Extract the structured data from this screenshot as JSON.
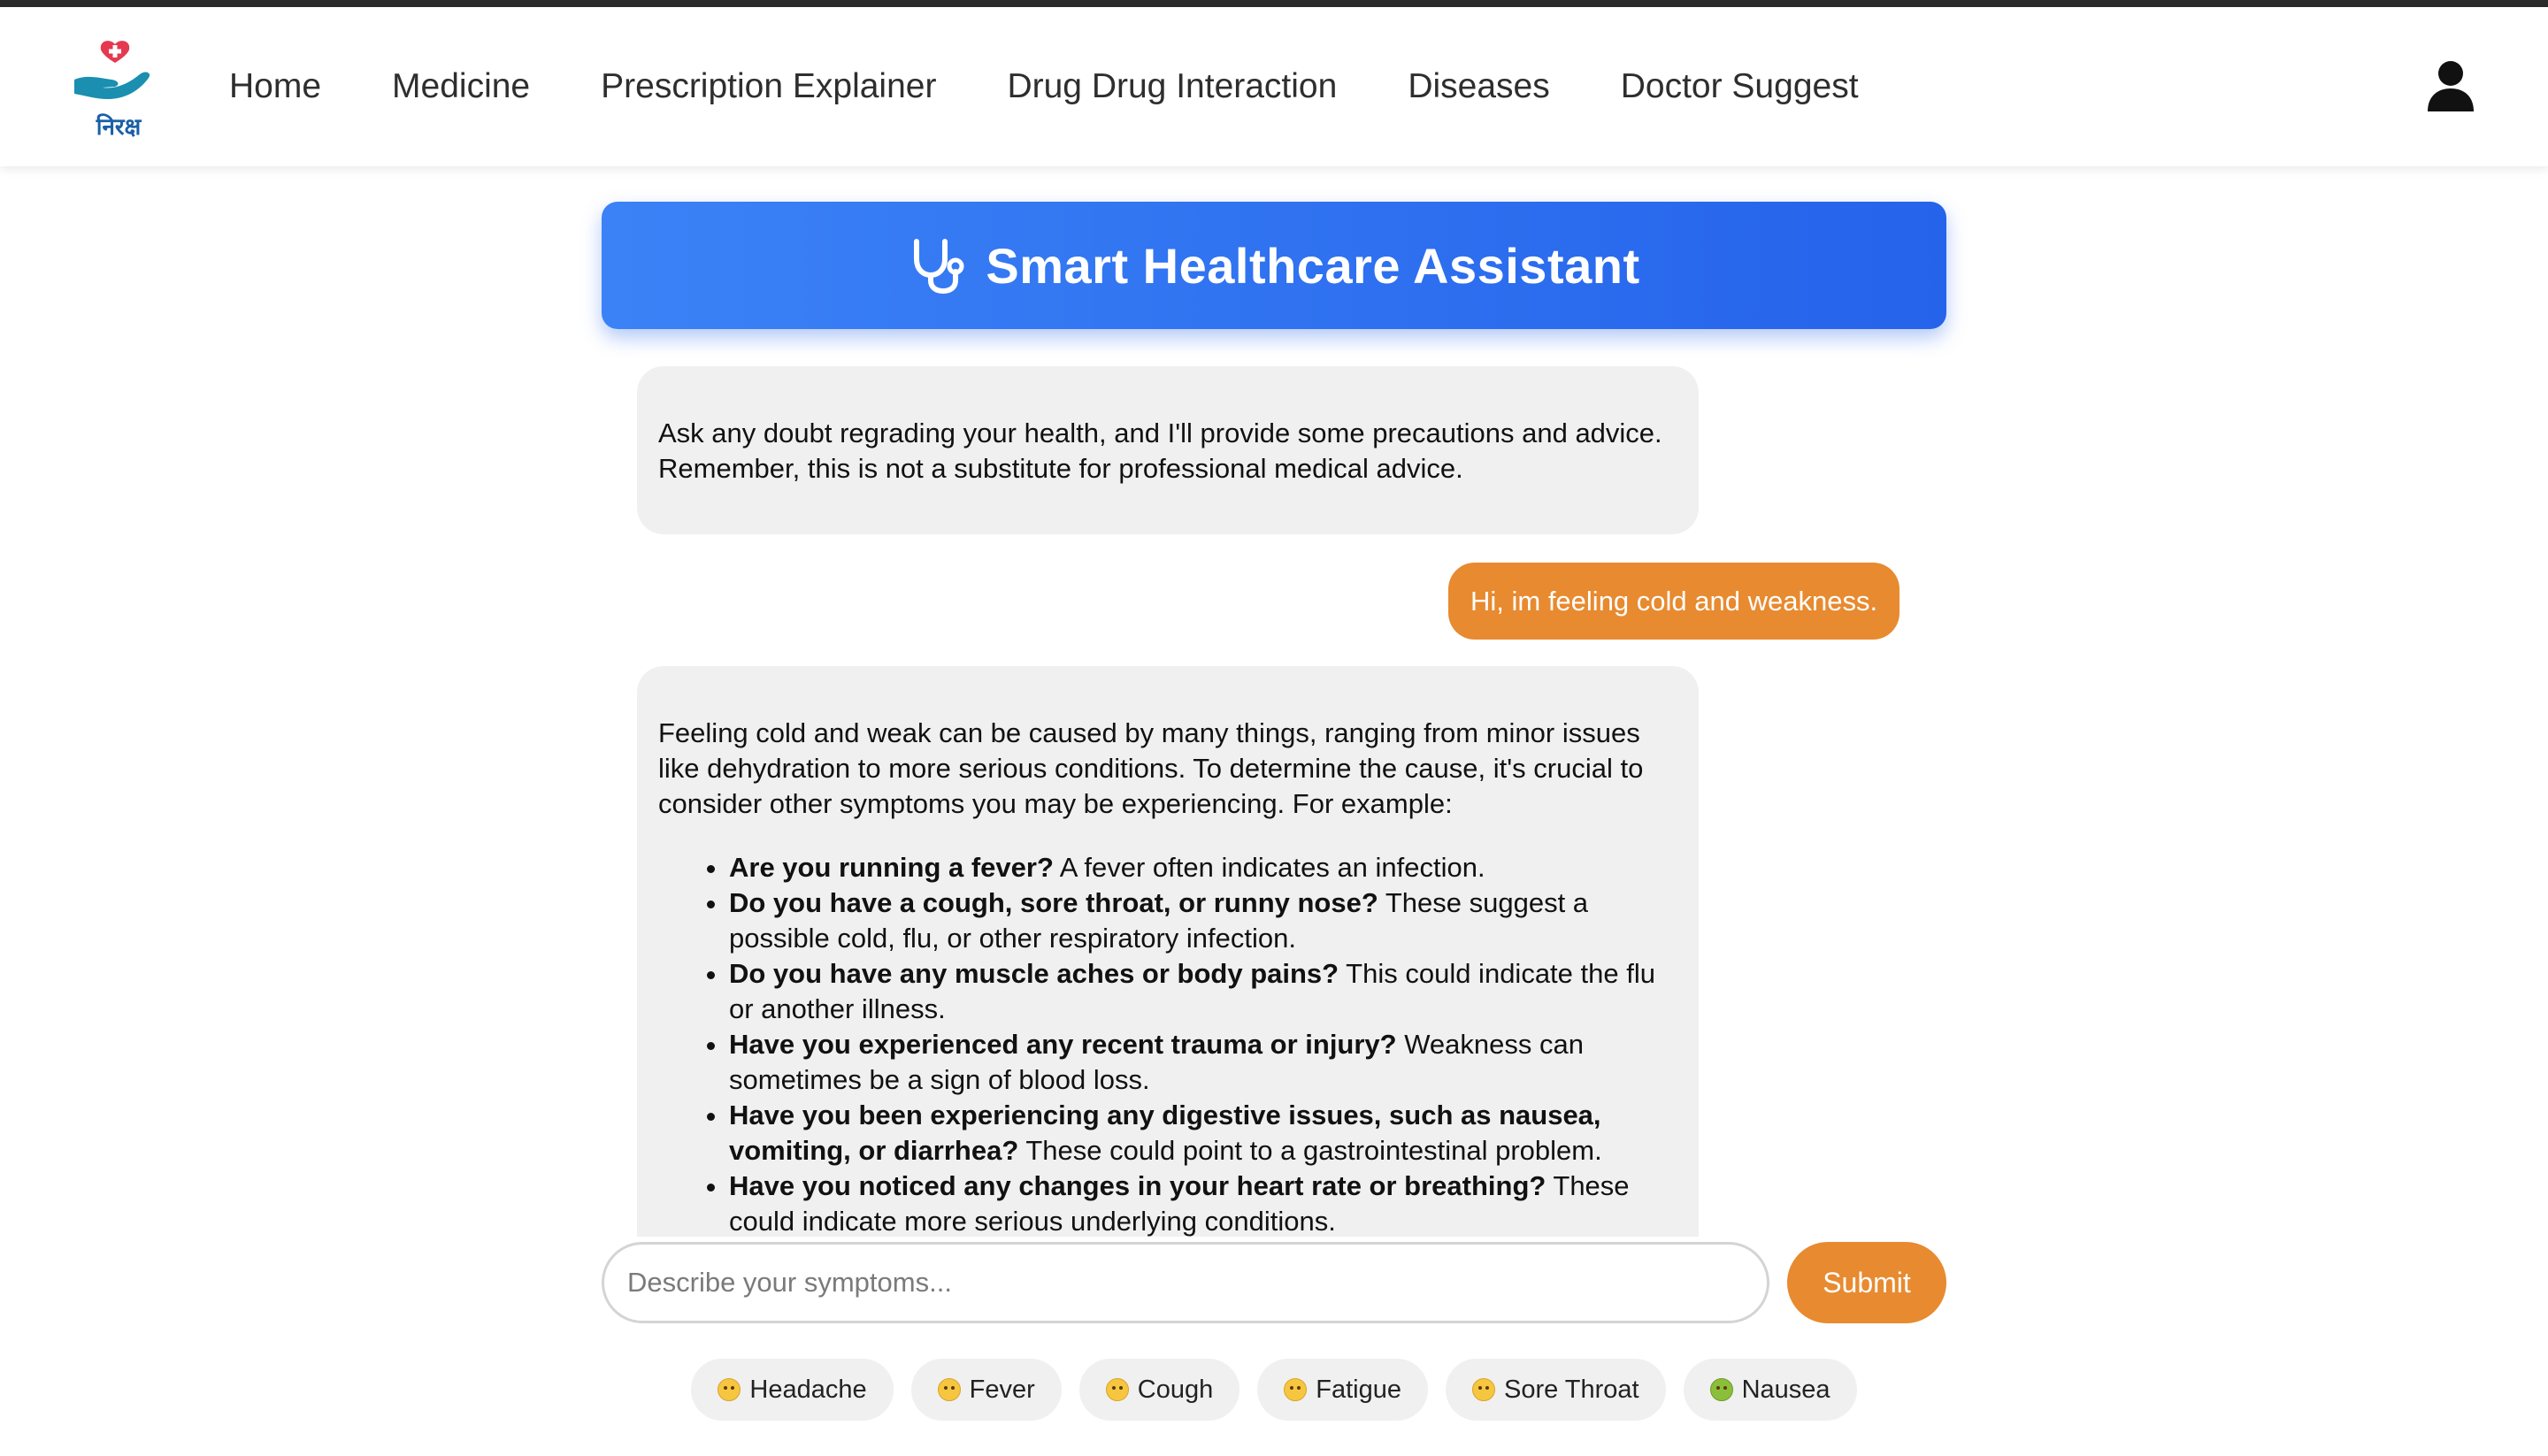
{
  "app": {
    "logo_text": "निरक्ष",
    "brand_colors": {
      "primary_blue": "#2563eb",
      "accent_orange": "#e88a2f",
      "logo_teal": "#1a8fb0",
      "logo_heart": "#e53950"
    }
  },
  "nav": {
    "links": [
      {
        "label": "Home"
      },
      {
        "label": "Medicine"
      },
      {
        "label": "Prescription Explainer"
      },
      {
        "label": "Drug Drug Interaction"
      },
      {
        "label": "Diseases"
      },
      {
        "label": "Doctor Suggest"
      }
    ],
    "user_icon": "user-icon"
  },
  "header": {
    "icon": "stethoscope-icon",
    "title": "Smart Healthcare Assistant"
  },
  "chat": {
    "messages": [
      {
        "role": "bot",
        "text": "Ask any doubt regrading your health, and I'll provide some precautions and advice. Remember, this is not a substitute for professional medical advice."
      },
      {
        "role": "user",
        "text": "Hi, im feeling cold and weakness."
      },
      {
        "role": "bot",
        "intro": "Feeling cold and weak can be caused by many things, ranging from minor issues like dehydration to more serious conditions. To determine the cause, it's crucial to consider other symptoms you may be experiencing. For example:",
        "items": [
          {
            "bold": "Are you running a fever?",
            "text": " A fever often indicates an infection."
          },
          {
            "bold": "Do you have a cough, sore throat, or runny nose?",
            "text": " These suggest a possible cold, flu, or other respiratory infection."
          },
          {
            "bold": "Do you have any muscle aches or body pains?",
            "text": " This could indicate the flu or another illness."
          },
          {
            "bold": "Have you experienced any recent trauma or injury?",
            "text": " Weakness can sometimes be a sign of blood loss."
          },
          {
            "bold": "Have you been experiencing any digestive issues, such as nausea, vomiting, or diarrhea?",
            "text": " These could point to a gastrointestinal problem."
          },
          {
            "bold": "Have you noticed any changes in your heart rate or breathing?",
            "text": " These could indicate more serious underlying conditions."
          }
        ]
      }
    ]
  },
  "input": {
    "placeholder": "Describe your symptoms...",
    "value": "",
    "submit_label": "Submit"
  },
  "symptoms": [
    {
      "label": "Headache",
      "icon": "head-bandage-emoji-icon"
    },
    {
      "label": "Fever",
      "icon": "thermometer-face-emoji-icon"
    },
    {
      "label": "Cough",
      "icon": "face-exhaling-emoji-icon"
    },
    {
      "label": "Fatigue",
      "icon": "sweat-face-emoji-icon"
    },
    {
      "label": "Sore Throat",
      "icon": "sad-face-emoji-icon"
    },
    {
      "label": "Nausea",
      "icon": "nauseated-face-emoji-icon"
    }
  ]
}
